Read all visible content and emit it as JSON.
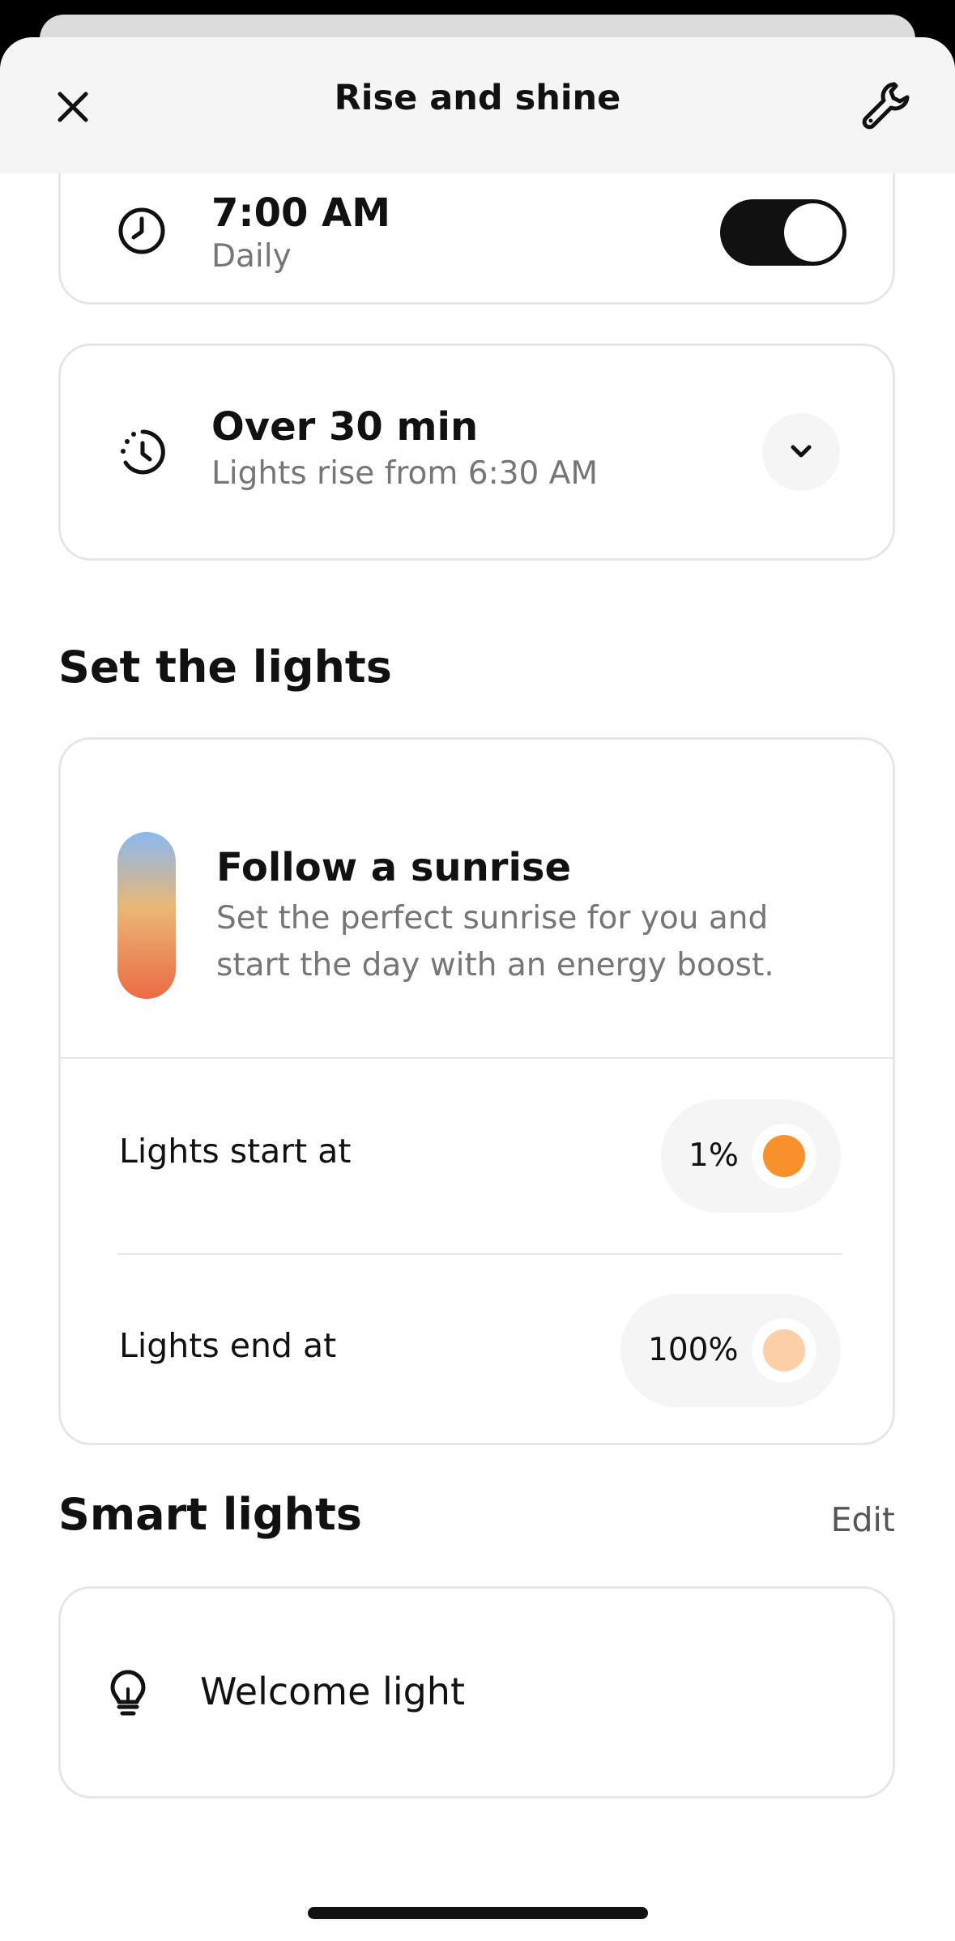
{
  "header": {
    "title": "Rise and shine",
    "close_icon": "close-icon",
    "settings_icon": "wrench-icon"
  },
  "alarm_card": {
    "time": "7:00 AM",
    "repeat": "Daily",
    "enabled": true,
    "icon": "clock-icon"
  },
  "duration_card": {
    "title": "Over 30 min",
    "subtitle": "Lights rise from 6:30 AM",
    "icon": "history-clock-icon",
    "expand_icon": "chevron-down-icon"
  },
  "set_lights": {
    "heading": "Set the lights",
    "sunrise": {
      "title": "Follow a sunrise",
      "description_line1": "Set the perfect sunrise for you and",
      "description_line2": "start the day with an energy boost.",
      "gradient_colors": [
        "#8ab8f0",
        "#e9b774",
        "#ec6b45"
      ]
    },
    "start": {
      "label": "Lights start at",
      "value": "1%",
      "color": "#f8912b"
    },
    "end": {
      "label": "Lights end at",
      "value": "100%",
      "color": "#fdcfa6"
    }
  },
  "smart_lights": {
    "heading": "Smart lights",
    "edit_label": "Edit",
    "items": [
      {
        "name": "Welcome light",
        "icon": "lightbulb-icon"
      }
    ]
  }
}
